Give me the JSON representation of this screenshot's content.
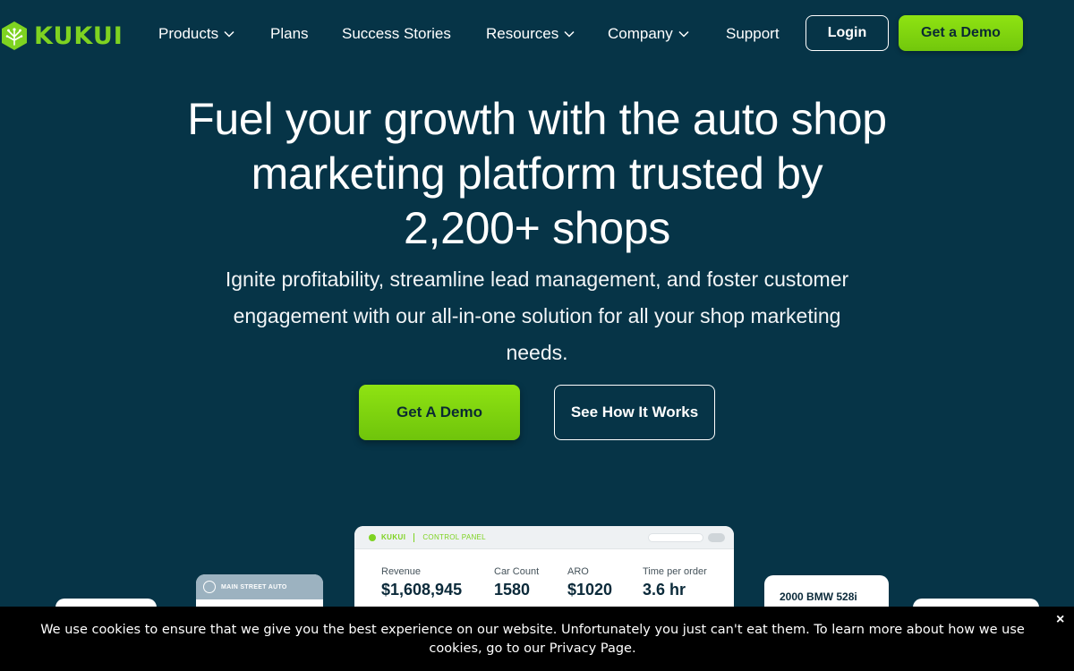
{
  "brand": {
    "name": "KUKUI",
    "accent": "#7ed321",
    "background": "#063447"
  },
  "nav": {
    "items": [
      {
        "label": "Products",
        "has_dropdown": true
      },
      {
        "label": "Plans",
        "has_dropdown": false
      },
      {
        "label": "Success Stories",
        "has_dropdown": false
      },
      {
        "label": "Resources",
        "has_dropdown": true
      },
      {
        "label": "Company",
        "has_dropdown": true
      },
      {
        "label": "Support",
        "has_dropdown": false
      }
    ],
    "login_label": "Login",
    "demo_label": "Get a Demo"
  },
  "hero": {
    "title": "Fuel your growth with the auto shop marketing platform trusted by 2,200+ shops",
    "subtitle": "Ignite profitability, streamline  lead management, and foster customer engagement with our all-in-one solution for all your shop marketing needs.",
    "primary_cta": "Get A Demo",
    "secondary_cta": "See How It Works"
  },
  "dashboard": {
    "logo_text": "KUKUI",
    "section": "CONTROL PANEL",
    "metrics": [
      {
        "label": "Revenue",
        "value": "$1,608,945"
      },
      {
        "label": "Car Count",
        "value": "1580"
      },
      {
        "label": "ARO",
        "value": "$1020"
      },
      {
        "label": "Time per order",
        "value": "3.6 hr"
      }
    ],
    "shop_card_title": "MAIN STREET AUTO",
    "car_card_title": "2000 BMW 528i"
  },
  "cookie": {
    "text": "We use cookies to ensure that we give you the best experience on our website. Unfortunately you just can't eat them. To learn more about how we use cookies, go to our Privacy Page.",
    "close_label": "×"
  }
}
